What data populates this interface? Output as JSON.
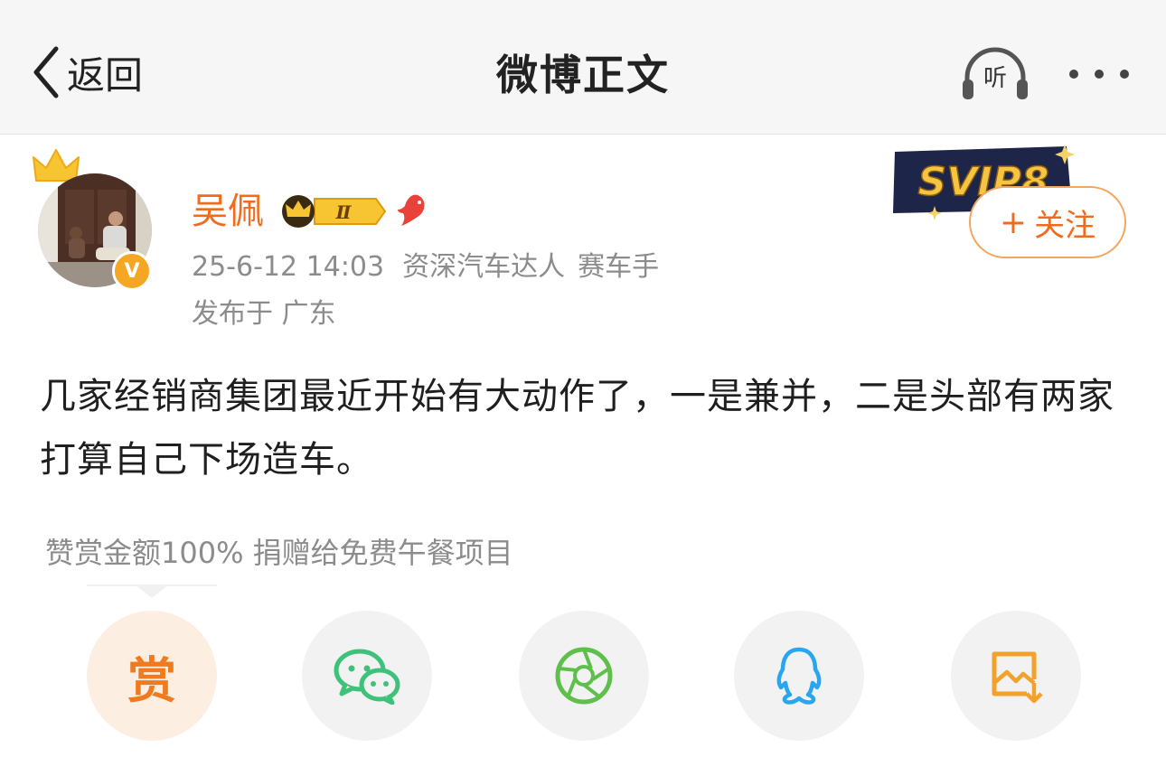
{
  "header": {
    "back_label": "返回",
    "title": "微博正文",
    "listen_label": "听"
  },
  "post": {
    "author": {
      "name": "吴佩",
      "level_badge": "Ⅱ",
      "verified_mark": "V"
    },
    "svip_badge": "SVIP8",
    "follow_button": {
      "plus": "+",
      "label": "关注"
    },
    "meta": {
      "datetime": "25-6-12 14:03",
      "tags": [
        "资深汽车达人",
        "赛车手"
      ],
      "location": "发布于 广东"
    },
    "text": "几家经销商集团最近开始有大动作了，一是兼并，二是头部有两家打算自己下场造车。"
  },
  "reward": {
    "note": "赞赏金额100% 捐赠给免费午餐项目",
    "button_label": "赏"
  },
  "share_actions": [
    "reward",
    "wechat",
    "moments",
    "qq",
    "save-image"
  ],
  "colors": {
    "accent": "#f26b1d",
    "meta_text": "#8c8c8c",
    "header_bg": "#f6f6f6",
    "wechat": "#3ec27a",
    "moments": "#5ec04a",
    "qq": "#2aa6f0",
    "save_image": "#f2a12a"
  }
}
